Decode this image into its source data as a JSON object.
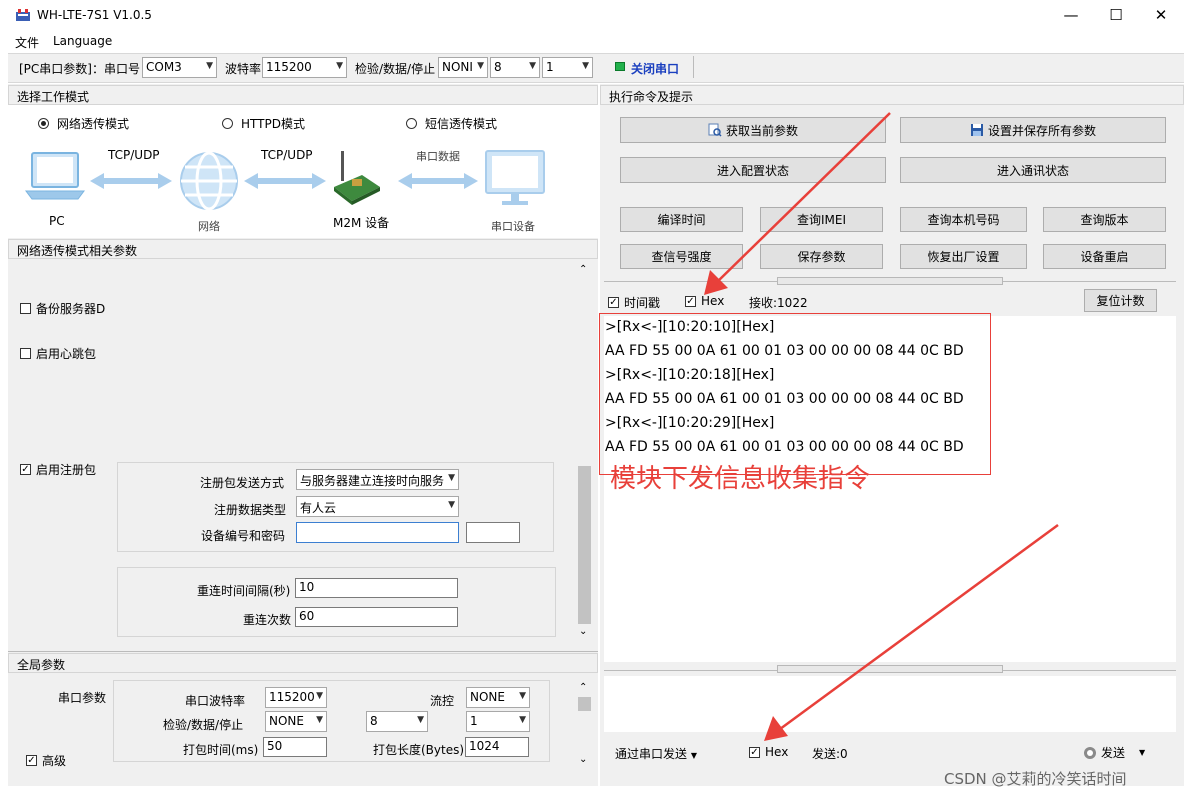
{
  "window": {
    "title": "WH-LTE-7S1 V1.0.5",
    "minimize": "—",
    "maximize": "☐",
    "close": "✕"
  },
  "menu": [
    "文件",
    "Language"
  ],
  "toolbar": {
    "serial_params": "[PC串口参数]：串口号",
    "port": "COM3",
    "baud_label": "波特率",
    "baud": "115200",
    "parity_label": "检验/数据/停止",
    "parity": "NONI",
    "data_bits": "8",
    "stop_bits": "1",
    "close_port": "关闭串口",
    "status_color": "#22b14c"
  },
  "left": {
    "work_mode_header": "选择工作模式",
    "modes": [
      "网络透传模式",
      "HTTPD模式",
      "短信透传模式"
    ],
    "selected_mode": 0,
    "diagram": {
      "pc": "PC",
      "tcp1": "TCP/UDP",
      "network": "网络",
      "tcp2": "TCP/UDP",
      "m2m": "M2M 设备",
      "serial_data": "串口数据",
      "serial_device": "串口设备"
    },
    "net_params_header": "网络透传模式相关参数",
    "backup_server": "备份服务器D",
    "heartbeat": "启用心跳包",
    "register": "启用注册包",
    "reg_send_label": "注册包发送方式",
    "reg_send_value": "与服务器建立连接时向服务",
    "reg_type_label": "注册数据类型",
    "reg_type_value": "有人云",
    "device_id_label": "设备编号和密码",
    "reconnect_label": "重连时间间隔(秒)",
    "reconnect_value": "10",
    "retry_label": "重连次数",
    "retry_value": "60",
    "global_header": "全局参数",
    "serial_params_label": "串口参数",
    "g_baud_label": "串口波特率",
    "g_baud": "115200",
    "flow_label": "流控",
    "flow": "NONE",
    "g_parity_label": "检验/数据/停止",
    "g_parity": "NONE",
    "g_data": "8",
    "g_stop": "1",
    "pack_time_label": "打包时间(ms)",
    "pack_time": "50",
    "pack_len_label": "打包长度(Bytes)",
    "pack_len": "1024",
    "advanced": "高级"
  },
  "right": {
    "header": "执行命令及提示",
    "btn_get_params": "获取当前参数",
    "btn_set_save": "设置并保存所有参数",
    "btn_enter_config": "进入配置状态",
    "btn_enter_comm": "进入通讯状态",
    "btn_compile_time": "编译时间",
    "btn_imei": "查询IMEI",
    "btn_local_number": "查询本机号码",
    "btn_version": "查询版本",
    "btn_signal": "查信号强度",
    "btn_save_params": "保存参数",
    "btn_factory": "恢复出厂设置",
    "btn_restart": "设备重启",
    "timestamp_cb": "时间戳",
    "hex_cb": "Hex",
    "recv_count": "接收:1022",
    "reset_count": "复位计数",
    "log": [
      ">[Rx<-][10:20:10][Hex]",
      "AA FD 55 00 0A 61 00 01 03 00 00 00 08 44 0C BD",
      ">[Rx<-][10:20:18][Hex]",
      "AA FD 55 00 0A 61 00 01 03 00 00 00 08 44 0C BD",
      ">[Rx<-][10:20:29][Hex]",
      "AA FD 55 00 0A 61 00 01 03 00 00 00 08 44 0C BD"
    ],
    "annotation": "模块下发信息收集指令",
    "annotation_color": "#e8403a",
    "send_via": "通过串口发送",
    "send_hex_cb": "Hex",
    "send_count": "发送:0",
    "send_btn": "发送"
  },
  "watermark": "CSDN @艾莉的冷笑话时间"
}
